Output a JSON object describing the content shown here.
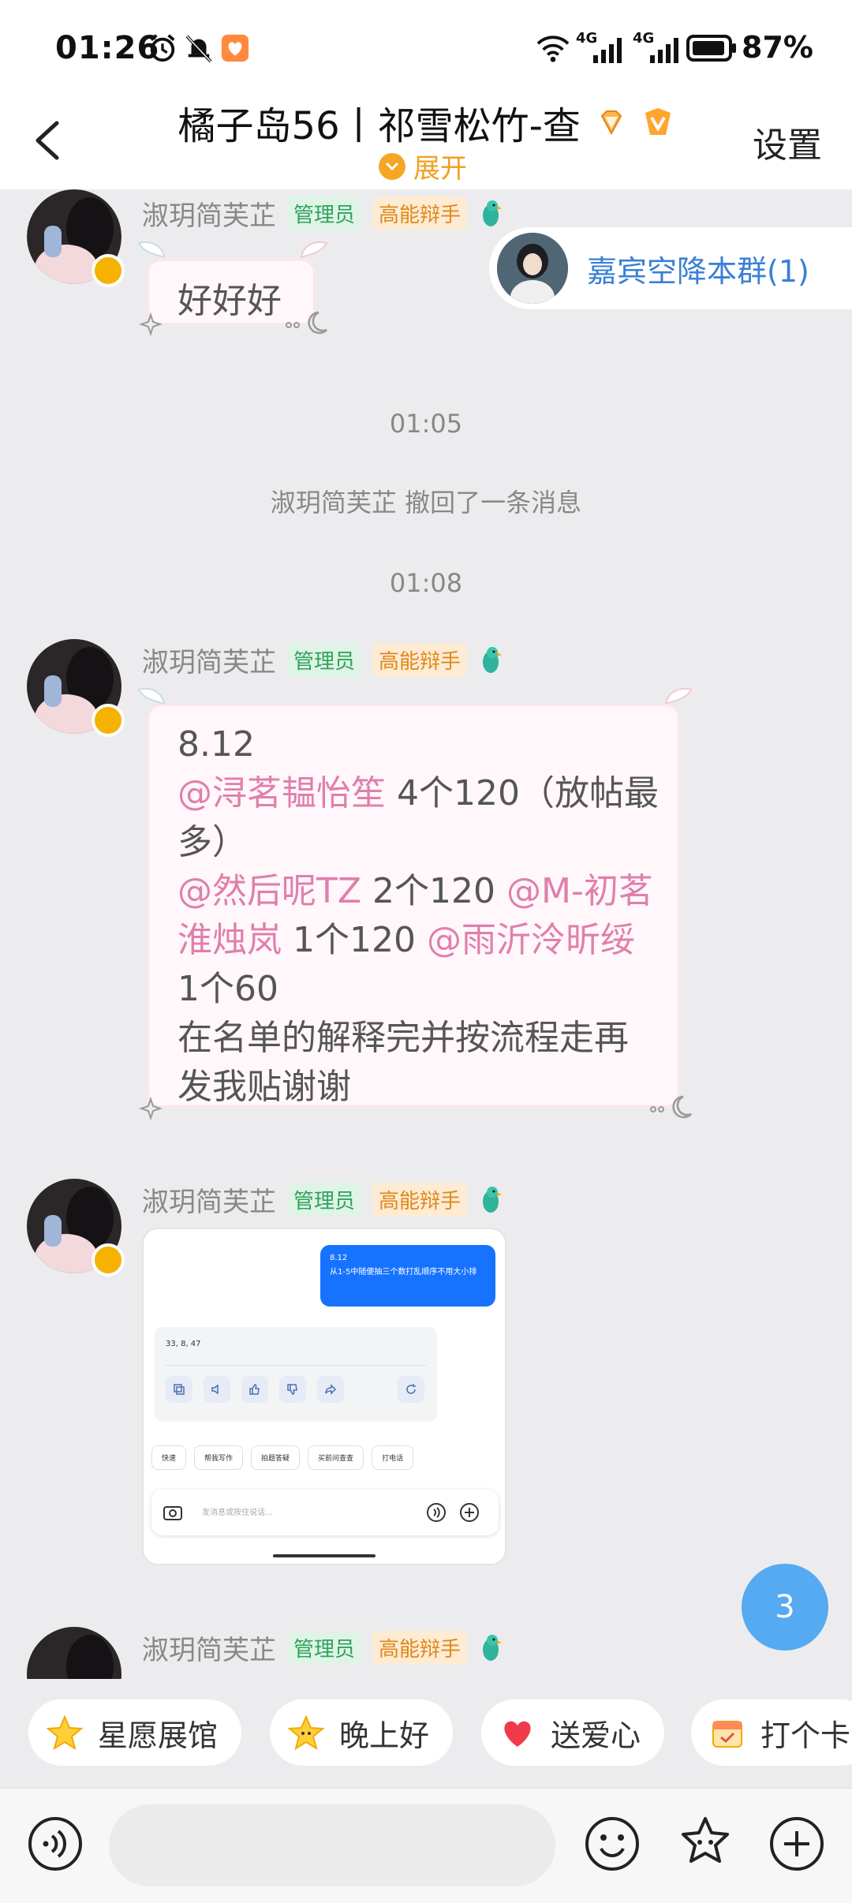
{
  "status_bar": {
    "time": "01:26",
    "network_1": "4G",
    "network_2": "4G",
    "battery": "87%"
  },
  "header": {
    "title": "橘子岛56丨祁雪松竹-查",
    "expand_label": "展开",
    "settings_label": "设置"
  },
  "guest_banner": {
    "label": "嘉宾空降本群(1)"
  },
  "messages": [
    {
      "sender": "淑玥简芙芷",
      "tag_admin": "管理员",
      "tag_talent": "高能辩手",
      "text": "好好好"
    },
    {
      "sender": "淑玥简芙芷",
      "tag_admin": "管理员",
      "tag_talent": "高能辩手",
      "line1": "8.12",
      "m1": "@浔茗韫怡笙",
      "t1": "  4个120（放帖最多）",
      "m2": "@然后呢TZ",
      "t2": " 2个120 ",
      "m3": "@M-初茗淮烛岚",
      "t3": " 1个120 ",
      "m4": "@雨沂泠昕绥",
      "t4": " 1个60",
      "t5": "在名单的解释完并按流程走再发我贴谢谢"
    },
    {
      "sender": "淑玥简芙芷",
      "tag_admin": "管理员",
      "tag_talent": "高能辩手",
      "image": {
        "sent_date": "8.12",
        "sent_text": "从1-5中随便抽三个数打乱顺序不用大小排",
        "reply_text": "33, 8, 47",
        "chip_1": "快速",
        "chip_2": "帮我写作",
        "chip_3": "拍题答疑",
        "chip_4": "买前问查查",
        "chip_5": "打电话",
        "input_placeholder": "发消息或按住说话..."
      }
    },
    {
      "sender": "淑玥简芙芷",
      "tag_admin": "管理员",
      "tag_talent": "高能辩手"
    }
  ],
  "timestamps": {
    "t1": "01:05",
    "t2": "01:08"
  },
  "notice": "淑玥简芙芷 撤回了一条消息",
  "unread_count": "3",
  "quick_chips": [
    {
      "label": "星愿展馆"
    },
    {
      "label": "晚上好"
    },
    {
      "label": "送爱心"
    },
    {
      "label": "打个卡"
    }
  ],
  "colors": {
    "mention": "#e07fac",
    "admin_tag": "#2fa35a",
    "talent_tag": "#e0891a",
    "guest_link": "#3a7fd6",
    "unread_badge": "#55aaf1"
  }
}
